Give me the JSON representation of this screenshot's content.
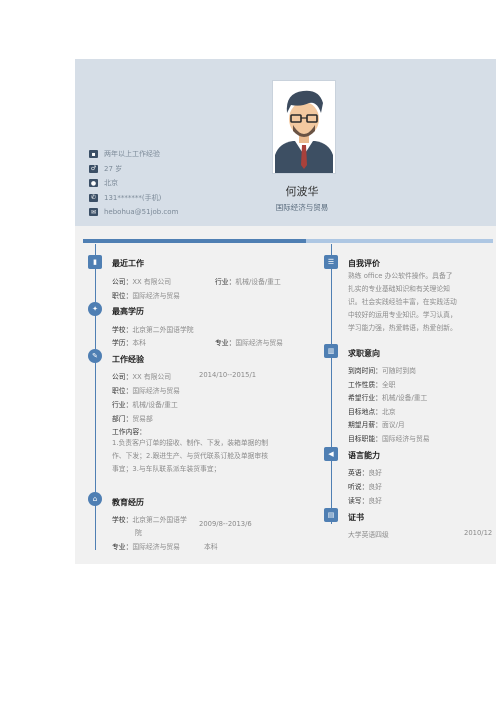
{
  "header": {
    "name": "何波华",
    "major": "国际经济与贸易",
    "contacts": [
      {
        "icon": "briefcase-icon",
        "text": "两年以上工作经验"
      },
      {
        "icon": "gender-icon",
        "text": "27 岁"
      },
      {
        "icon": "location-pin-icon",
        "text": "北京"
      },
      {
        "icon": "phone-icon",
        "text": "131*******(手机)"
      },
      {
        "icon": "email-icon",
        "text": "hebohua@51job.com"
      }
    ]
  },
  "left": {
    "recent_work": {
      "title": "最近工作",
      "company_label": "公司：",
      "company": "XX 有限公司",
      "industry_label": "行业：",
      "industry": "机械/设备/重工",
      "position_label": "职位：",
      "position": "国际经济与贸易"
    },
    "education_top": {
      "title": "最高学历",
      "school_label": "学校：",
      "school": "北京第二外国语学院",
      "degree_label": "学历：",
      "degree": "本科",
      "major_label": "专业：",
      "major": "国际经济与贸易"
    },
    "work_experience": {
      "title": "工作经验",
      "company_label": "公司：",
      "company": "XX 有限公司",
      "period": "2014/10--2015/1",
      "position_label": "职位：",
      "position": "国际经济与贸易",
      "industry_label": "行业：",
      "industry": "机械/设备/重工",
      "dept_label": "部门：",
      "dept": "贸易部",
      "content_label": "工作内容：",
      "content_lines": [
        "1.负责客户订单的接收、制作、下发，装箱单据的制",
        "作、下发；2.跟进生产、与货代联系订舱及单据审核",
        "事宜；3.与车队联系派车装货事宜；"
      ]
    },
    "education": {
      "title": "教育经历",
      "school_label": "学校：",
      "school_line1": "北京第二外国语学",
      "school_line2": "院",
      "period": "2009/8--2013/6",
      "major_label": "专业：",
      "major": "国际经济与贸易",
      "degree": "本科"
    }
  },
  "right": {
    "self_eval": {
      "title": "自我评价",
      "lines": [
        "熟练 office 办公软件操作。具备了",
        "扎实的专业基础知识和有关理论知",
        "识。社会实践经验丰富，在实践活动",
        "中较好的运用专业知识。学习认真，",
        "学习能力强，热爱韩语，热爱创新。"
      ]
    },
    "intent": {
      "title": "求职意向",
      "rows": [
        {
          "label": "到岗时间：",
          "value": "可随时到岗"
        },
        {
          "label": "工作性质：",
          "value": "全职"
        },
        {
          "label": "希望行业：",
          "value": "机械/设备/重工"
        },
        {
          "label": "目标地点：",
          "value": "北京"
        },
        {
          "label": "期望月薪：",
          "value": "面议/月"
        },
        {
          "label": "目标职能：",
          "value": "国际经济与贸易"
        }
      ]
    },
    "language": {
      "title": "语言能力",
      "rows": [
        {
          "label": "英语：",
          "value": "良好"
        },
        {
          "label": "听说：",
          "value": "良好"
        },
        {
          "label": "读写：",
          "value": "良好"
        }
      ]
    },
    "cert": {
      "title": "证书",
      "name": "大学英语四级",
      "date": "2010/12"
    }
  },
  "colors": {
    "accent": "#4f7fb3",
    "header_bg": "#d6dee7",
    "icon_dark": "#3b4f66"
  }
}
